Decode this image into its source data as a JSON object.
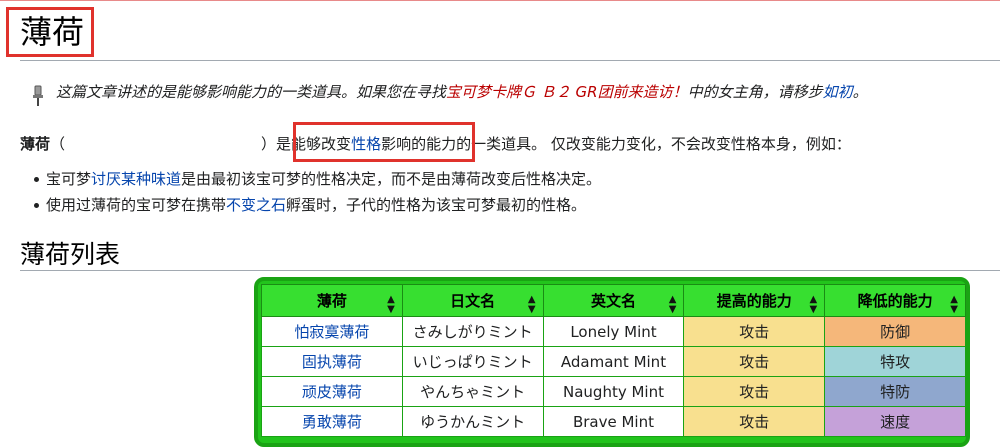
{
  "page": {
    "title": "薄荷"
  },
  "hatnote": {
    "before": "这篇文章讲述的是能够影响能力的一类道具。如果您在寻找",
    "link_red": "宝可梦卡牌Ｇ Ｂ２ GR团前来造访！",
    "middle": "中的女主角，请移步",
    "link_blue": "如初",
    "after": "。",
    "icon": "pushpin-icon"
  },
  "lead": {
    "bold": "薄荷",
    "open_paren": "（",
    "close_paren": "）是",
    "t1": "能够改变",
    "link1": "性格",
    "t2": "影响的能力",
    "t3": "的一类道具。 仅改变能力变化，不会改变性格本身，例如："
  },
  "bullets": [
    {
      "a": "宝可梦",
      "link": "讨厌某种味道",
      "b": "是由最初该宝可梦的性格决定，而不是由薄荷改变后性格决定。"
    },
    {
      "a": "使用过薄荷的宝可梦在携带",
      "link": "不变之石",
      "b": "孵蛋时，子代的性格为该宝可梦最初的性格。"
    }
  ],
  "section": {
    "title": "薄荷列表"
  },
  "table": {
    "headers": [
      "薄荷",
      "日文名",
      "英文名",
      "提高的能力",
      "降低的能力"
    ],
    "sort_icon": "sort-arrows-icon",
    "rows": [
      {
        "name": "怕寂寞薄荷",
        "jp": "さみしがりミント",
        "en": "Lonely Mint",
        "up": "攻击",
        "down": "防御",
        "down_color": "#f5b77a"
      },
      {
        "name": "固执薄荷",
        "jp": "いじっぱりミント",
        "en": "Adamant Mint",
        "up": "攻击",
        "down": "特攻",
        "down_color": "#9fd4d8"
      },
      {
        "name": "顽皮薄荷",
        "jp": "やんちゃミント",
        "en": "Naughty Mint",
        "up": "攻击",
        "down": "特防",
        "down_color": "#8fa7ce"
      },
      {
        "name": "勇敢薄荷",
        "jp": "ゆうかんミント",
        "en": "Brave Mint",
        "up": "攻击",
        "down": "速度",
        "down_color": "#c5a1d9"
      }
    ],
    "up_color": "#f8e08f"
  }
}
